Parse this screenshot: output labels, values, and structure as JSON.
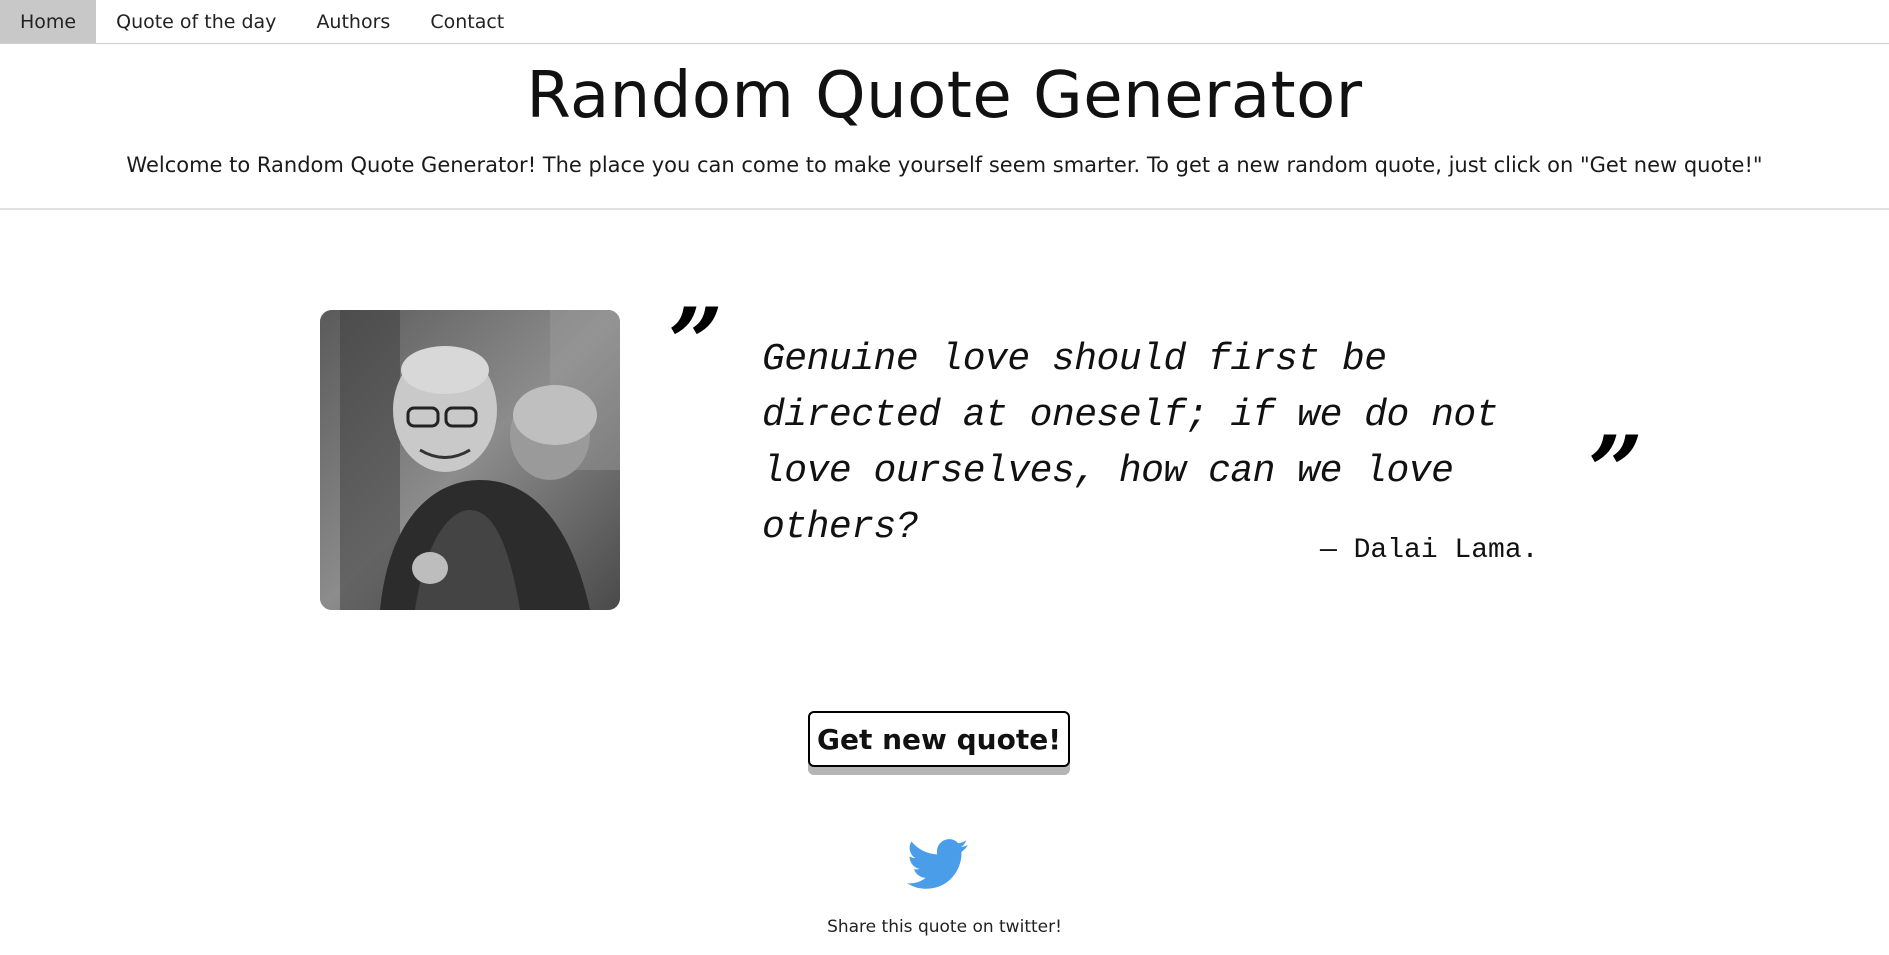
{
  "nav": {
    "items": [
      {
        "label": "Home",
        "active": true
      },
      {
        "label": "Quote of the day",
        "active": false
      },
      {
        "label": "Authors",
        "active": false
      },
      {
        "label": "Contact",
        "active": false
      }
    ]
  },
  "header": {
    "title": "Random Quote Generator",
    "intro": "Welcome to Random Quote Generator! The place you can come to make yourself seem smarter. To get a new random quote, just click on \"Get new quote!\""
  },
  "quote": {
    "open_mark": "”",
    "close_mark": "”",
    "text": "Genuine love should first be directed at oneself; if we do not love ourselves, how can we love others?",
    "author": "— Dalai Lama."
  },
  "actions": {
    "new_quote_label": "Get new quote!",
    "share_label": "Share this quote on twitter!"
  },
  "colors": {
    "twitter": "#4a9de8",
    "nav_active_bg": "#c8c8c8",
    "button_shadow": "#b5b5b5"
  }
}
